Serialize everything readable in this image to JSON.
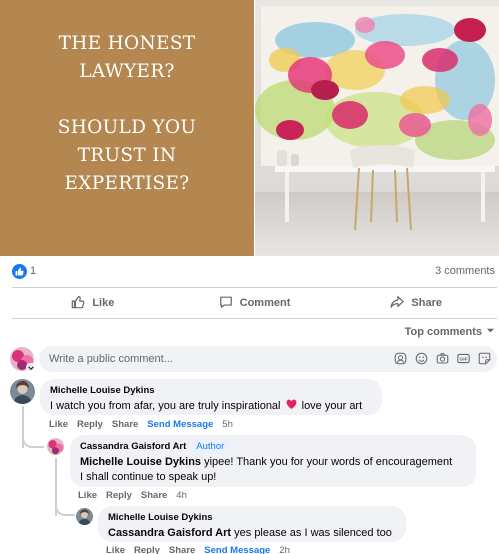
{
  "post": {
    "banner_lines_1": [
      "THE HONEST",
      "LAWYER?"
    ],
    "banner_lines_2": [
      "SHOULD YOU",
      "TRUST IN",
      "EXPERTISE?"
    ],
    "reaction_count": "1",
    "comments_count": "3 comments"
  },
  "actions": {
    "like": "Like",
    "comment": "Comment",
    "share": "Share"
  },
  "sort": {
    "label": "Top comments"
  },
  "composer": {
    "placeholder": "Write a public comment..."
  },
  "comments": [
    {
      "name": "Michelle Louise Dykins",
      "text_before": "I watch you from afar, you are truly inspirational",
      "emoji": "❤️",
      "text_after": "love your art",
      "like": "Like",
      "reply": "Reply",
      "share": "Share",
      "send": "Send Message",
      "time": "5h"
    },
    {
      "name": "Cassandra Gaisford Art",
      "badge": "Author",
      "mention": "Michelle Louise Dykins",
      "text_line1": "yipee! Thank you for your words of encouragement",
      "text_line2": "I shall continue to speak up!",
      "like": "Like",
      "reply": "Reply",
      "share": "Share",
      "time": "4h"
    },
    {
      "name": "Michelle Louise Dykins",
      "mention": "Cassandra Gaisford Art",
      "text": "yes please as I was silenced too",
      "like": "Like",
      "reply": "Reply",
      "share": "Share",
      "send": "Send Message",
      "time": "2h"
    }
  ],
  "colors": {
    "banner_bg": "#b3874f",
    "facebook_blue": "#1877f2",
    "bubble_bg": "#f0f2f5",
    "meta_gray": "#65676b"
  }
}
